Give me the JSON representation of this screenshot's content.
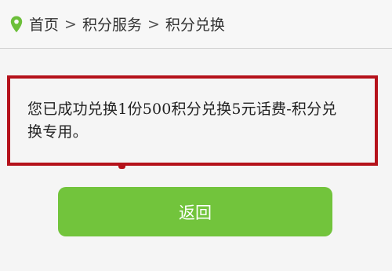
{
  "breadcrumb": {
    "icon": "location-pin-icon",
    "icon_color": "#6cbf3a",
    "items": [
      "首页",
      "积分服务",
      "积分兑换"
    ],
    "separator": ">"
  },
  "message": {
    "line1": "您已成功兑换1份500积分兑换5元话费-积分兑",
    "line2": "换专用。",
    "border_color": "#b5121b"
  },
  "actions": {
    "back_label": "返回",
    "button_color": "#72c43c"
  }
}
